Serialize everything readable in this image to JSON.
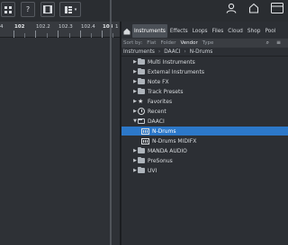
{
  "toolbar": {
    "grid_label": "⊞",
    "help_label": "?",
    "video_label": "▭",
    "layout_label": "▦"
  },
  "ruler": {
    "labels": [
      "4",
      "102",
      "102.2",
      "102.3",
      "102.4",
      "103",
      "1"
    ]
  },
  "browser": {
    "tabs": [
      "Instruments",
      "Effects",
      "Loops",
      "Files",
      "Cloud",
      "Shop",
      "Pool"
    ],
    "active_tab": "Instruments",
    "sort": {
      "label": "Sort by:",
      "options": [
        "Flat",
        "Folder",
        "Vendor",
        "Type"
      ],
      "active": "Vendor"
    },
    "breadcrumb": [
      "Instruments",
      "DAACI",
      "N-Drums"
    ],
    "tree": [
      {
        "label": "Multi Instruments",
        "icon": "folder-icon",
        "level": 1
      },
      {
        "label": "External Instruments",
        "icon": "folder-icon",
        "level": 1
      },
      {
        "label": "Note FX",
        "icon": "folder-icon",
        "level": 1
      },
      {
        "label": "Track Presets",
        "icon": "folder-icon",
        "level": 1
      },
      {
        "label": "Favorites",
        "icon": "star-icon",
        "level": 1
      },
      {
        "label": "Recent",
        "icon": "clock-icon",
        "level": 1
      },
      {
        "label": "DAACI",
        "icon": "folder-open-icon",
        "level": 0
      },
      {
        "label": "N-Drums",
        "icon": "instrument-icon",
        "level": 2,
        "selected": true
      },
      {
        "label": "N-Drums MIDIFX",
        "icon": "instrument-icon",
        "level": 2
      },
      {
        "label": "MANDA AUDIO",
        "icon": "folder-icon",
        "level": 1
      },
      {
        "label": "PreSonus",
        "icon": "folder-icon",
        "level": 1
      },
      {
        "label": "UVI",
        "icon": "folder-icon",
        "level": 1
      }
    ]
  },
  "colors": {
    "selection": "#2c78c9",
    "panel": "#2c2f34"
  }
}
